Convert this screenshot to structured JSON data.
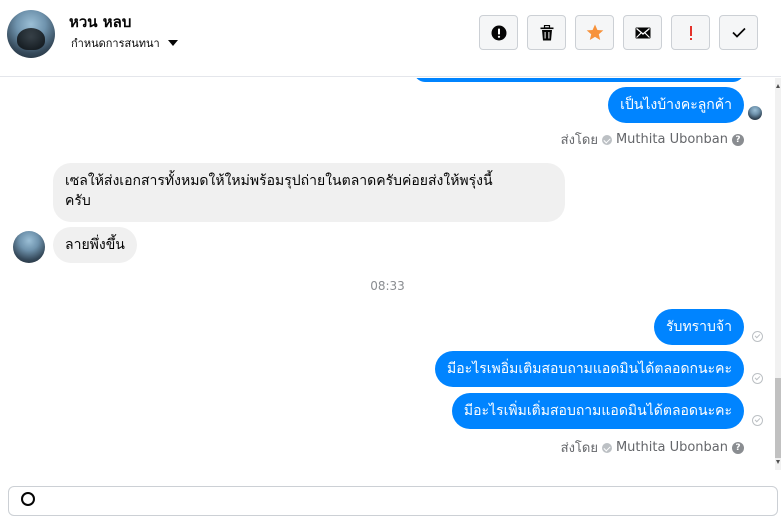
{
  "header": {
    "contact_name": "หวน หลบ",
    "subtitle": "กำหนดการสนทนา",
    "actions": [
      {
        "name": "spam",
        "icon": "alert-circle-icon"
      },
      {
        "name": "delete",
        "icon": "trash-icon"
      },
      {
        "name": "star",
        "icon": "star-icon",
        "color": "#f7923b"
      },
      {
        "name": "mark-unread",
        "icon": "envelope-icon"
      },
      {
        "name": "important",
        "icon": "exclamation-icon",
        "color": "#e4322b"
      },
      {
        "name": "done",
        "icon": "check-icon"
      }
    ]
  },
  "messages": [
    {
      "side": "out",
      "text": "เป็นไงบ้างคะลูกค้า"
    },
    {
      "side": "in",
      "text_line1": "เซลให้ส่งเอกสารทั้งหมดให้ใหม่พร้อมรุปถ่ายในตลาดครับค่อยส่งให้พรุ่งนี้",
      "text_line2": "ครับ"
    },
    {
      "side": "in",
      "text": "ลายพึ่งขึ้น"
    },
    {
      "side": "out",
      "text": "รับทราบจ้า"
    },
    {
      "side": "out",
      "text": "มีอะไรเพอิ่มเติมสอบถามแอดมินได้ตลอดกนะคะ"
    },
    {
      "side": "out",
      "text": "มีอะไรเพิ่มเติ่มสอบถามแอดมินได้ตลอดนะคะ"
    }
  ],
  "sent_by_1": {
    "label": "ส่งโดย",
    "agent": "Muthita Ubonban"
  },
  "sent_by_2": {
    "label": "ส่งโดย",
    "agent": "Muthita Ubonban"
  },
  "timestamp": "08:33",
  "colors": {
    "outgoing_bubble": "#0084ff",
    "incoming_bubble": "#f0f0f0",
    "star": "#f7923b",
    "important": "#e4322b"
  }
}
